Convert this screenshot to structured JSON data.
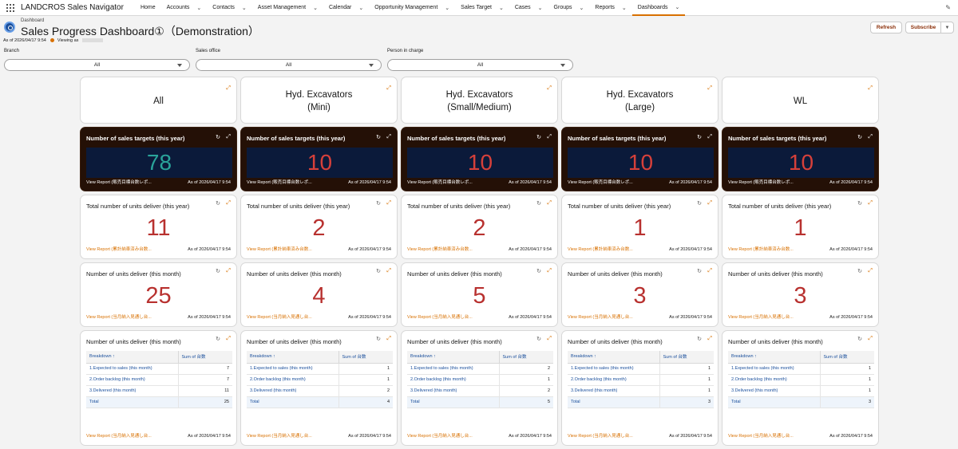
{
  "nav": {
    "app_name": "LANDCROS Sales Navigator",
    "items": [
      {
        "label": "Home",
        "chev": false,
        "active": false
      },
      {
        "label": "Accounts",
        "chev": true,
        "active": false
      },
      {
        "label": "Contacts",
        "chev": true,
        "active": false
      },
      {
        "label": "Asset Management",
        "chev": true,
        "active": false
      },
      {
        "label": "Calendar",
        "chev": true,
        "active": false
      },
      {
        "label": "Opportunity Management",
        "chev": true,
        "active": false
      },
      {
        "label": "Sales Target",
        "chev": true,
        "active": false
      },
      {
        "label": "Cases",
        "chev": true,
        "active": false
      },
      {
        "label": "Groups",
        "chev": true,
        "active": false
      },
      {
        "label": "Reports",
        "chev": true,
        "active": false
      },
      {
        "label": "Dashboards",
        "chev": true,
        "active": true
      }
    ]
  },
  "header": {
    "crumb": "Dashboard",
    "title": "Sales Progress Dashboard①（Demonstration）",
    "as_of": "As of 2026/04/17 9:54",
    "viewing_as": "Viewing as",
    "refresh_label": "Refresh",
    "subscribe_label": "Subscribe"
  },
  "filters": [
    {
      "label": "Branch",
      "value": "All"
    },
    {
      "label": "Sales office",
      "value": "All"
    },
    {
      "label": "Person in charge",
      "value": "All"
    }
  ],
  "columns": [
    {
      "heading": "All",
      "targets": {
        "title": "Number of sales targets (this year)",
        "value": "78",
        "color": "#2aa39a",
        "link": "View Report (販売目標台数レポ...",
        "as_of": "As of 2026/04/17 9:54"
      },
      "year_deliv": {
        "title": "Total number of units deliver (this year)",
        "value": "11",
        "link": "View Report (累計納車済み台数...",
        "as_of": "As of 2026/04/17 9:54"
      },
      "month_deliv": {
        "title": "Number of units deliver (this month)",
        "value": "25",
        "link": "View Report (当月納入見通し台...",
        "as_of": "As of 2026/04/17 9:54"
      },
      "table": {
        "title": "Number of units deliver (this month)",
        "col1": "Breakdown ↑",
        "col2": "Sum of 台数",
        "rows": [
          {
            "label": "1.Expected to sales (this month)",
            "value": "7"
          },
          {
            "label": "2.Order backlog (this month)",
            "value": "7"
          },
          {
            "label": "3.Delivered (this month)",
            "value": "11"
          }
        ],
        "total_label": "Total",
        "total": "25",
        "link": "View Report (当月納入見通し台...",
        "as_of": "As of 2026/04/17 9:54"
      }
    },
    {
      "heading": "Hyd. Excavators\n(Mini)",
      "targets": {
        "title": "Number of sales targets (this year)",
        "value": "10",
        "color": "#d6403a",
        "link": "View Report (販売目標台数レポ...",
        "as_of": "As of 2026/04/17 9:54"
      },
      "year_deliv": {
        "title": "Total number of units deliver (this year)",
        "value": "2",
        "link": "View Report (累計納車済み台数...",
        "as_of": "As of 2026/04/17 9:54"
      },
      "month_deliv": {
        "title": "Number of units deliver (this month)",
        "value": "4",
        "link": "View Report (当月納入見通し台...",
        "as_of": "As of 2026/04/17 9:54"
      },
      "table": {
        "title": "Number of units deliver (this month)",
        "col1": "Breakdown ↑",
        "col2": "Sum of 台数",
        "rows": [
          {
            "label": "1.Expected to sales (this month)",
            "value": "1"
          },
          {
            "label": "2.Order backlog (this month)",
            "value": "1"
          },
          {
            "label": "3.Delivered (this month)",
            "value": "2"
          }
        ],
        "total_label": "Total",
        "total": "4",
        "link": "View Report (当月納入見通し台...",
        "as_of": "As of 2026/04/17 9:54"
      }
    },
    {
      "heading": "Hyd. Excavators\n(Small/Medium)",
      "targets": {
        "title": "Number of sales targets (this year)",
        "value": "10",
        "color": "#d6403a",
        "link": "View Report (販売目標台数レポ...",
        "as_of": "As of 2026/04/17 9:54"
      },
      "year_deliv": {
        "title": "Total number of units deliver (this year)",
        "value": "2",
        "link": "View Report (累計納車済み台数...",
        "as_of": "As of 2026/04/17 9:54"
      },
      "month_deliv": {
        "title": "Number of units deliver (this month)",
        "value": "5",
        "link": "View Report (当月納入見通し台...",
        "as_of": "As of 2026/04/17 9:54"
      },
      "table": {
        "title": "Number of units deliver (this month)",
        "col1": "Breakdown ↑",
        "col2": "Sum of 台数",
        "rows": [
          {
            "label": "1.Expected to sales (this month)",
            "value": "2"
          },
          {
            "label": "2.Order backlog (this month)",
            "value": "1"
          },
          {
            "label": "3.Delivered (this month)",
            "value": "2"
          }
        ],
        "total_label": "Total",
        "total": "5",
        "link": "View Report (当月納入見通し台...",
        "as_of": "As of 2026/04/17 9:54"
      }
    },
    {
      "heading": "Hyd. Excavators\n(Large)",
      "targets": {
        "title": "Number of sales targets (this year)",
        "value": "10",
        "color": "#d6403a",
        "link": "View Report (販売目標台数レポ...",
        "as_of": "As of 2026/04/17 9:54"
      },
      "year_deliv": {
        "title": "Total number of units deliver (this year)",
        "value": "1",
        "link": "View Report (累計納車済み台数...",
        "as_of": "As of 2026/04/17 9:54"
      },
      "month_deliv": {
        "title": "Number of units deliver (this month)",
        "value": "3",
        "link": "View Report (当月納入見通し台...",
        "as_of": "As of 2026/04/17 9:54"
      },
      "table": {
        "title": "Number of units deliver (this month)",
        "col1": "Breakdown ↑",
        "col2": "Sum of 台数",
        "rows": [
          {
            "label": "1.Expected to sales (this month)",
            "value": "1"
          },
          {
            "label": "2.Order backlog (this month)",
            "value": "1"
          },
          {
            "label": "3.Delivered (this month)",
            "value": "1"
          }
        ],
        "total_label": "Total",
        "total": "3",
        "link": "View Report (当月納入見通し台...",
        "as_of": "As of 2026/04/17 9:54"
      }
    },
    {
      "heading": "WL",
      "targets": {
        "title": "Number of sales targets (this year)",
        "value": "10",
        "color": "#d6403a",
        "link": "View Report (販売目標台数レポ...",
        "as_of": "As of 2026/04/17 9:54"
      },
      "year_deliv": {
        "title": "Total number of units deliver (this year)",
        "value": "1",
        "link": "View Report (累計納車済み台数...",
        "as_of": "As of 2026/04/17 9:54"
      },
      "month_deliv": {
        "title": "Number of units deliver (this month)",
        "value": "3",
        "link": "View Report (当月納入見通し台...",
        "as_of": "As of 2026/04/17 9:54"
      },
      "table": {
        "title": "Number of units deliver (this month)",
        "col1": "Breakdown ↑",
        "col2": "Sum of 台数",
        "rows": [
          {
            "label": "1.Expected to sales (this month)",
            "value": "1"
          },
          {
            "label": "2.Order backlog (this month)",
            "value": "1"
          },
          {
            "label": "3.Delivered (this month)",
            "value": "1"
          }
        ],
        "total_label": "Total",
        "total": "3",
        "link": "View Report (当月納入見通し台...",
        "as_of": "As of 2026/04/17 9:54"
      }
    }
  ]
}
